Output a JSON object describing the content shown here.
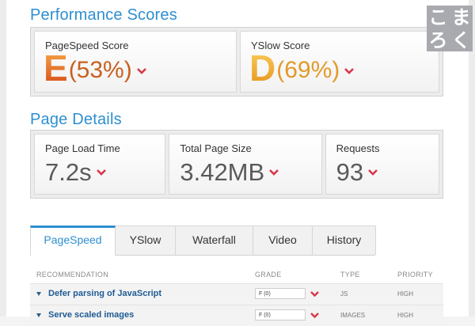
{
  "performance": {
    "title": "Performance Scores",
    "pagespeed": {
      "label": "PageSpeed Score",
      "grade": "E",
      "percent": "(53%)"
    },
    "yslow": {
      "label": "YSlow Score",
      "grade": "D",
      "percent": "(69%)"
    }
  },
  "details": {
    "title": "Page Details",
    "load_time": {
      "label": "Page Load Time",
      "value": "7.2s"
    },
    "page_size": {
      "label": "Total Page Size",
      "value": "3.42MB"
    },
    "requests": {
      "label": "Requests",
      "value": "93"
    }
  },
  "tabs": [
    {
      "label": "PageSpeed",
      "active": true
    },
    {
      "label": "YSlow",
      "active": false
    },
    {
      "label": "Waterfall",
      "active": false
    },
    {
      "label": "Video",
      "active": false
    },
    {
      "label": "History",
      "active": false
    }
  ],
  "table": {
    "headers": {
      "recommendation": "RECOMMENDATION",
      "grade": "GRADE",
      "type": "TYPE",
      "priority": "PRIORITY"
    },
    "rows": [
      {
        "name": "Defer parsing of JavaScript",
        "grade": "F (0)",
        "type": "JS",
        "priority": "HIGH"
      },
      {
        "name": "Serve scaled images",
        "grade": "F (0)",
        "type": "IMAGES",
        "priority": "HIGH"
      }
    ]
  },
  "logo": {
    "chars": [
      "こ",
      "ま",
      "ろ",
      "く"
    ]
  },
  "colors": {
    "accent": "#2e8fd0",
    "chevron": "#d8364a",
    "grade_e": "#e8762b",
    "grade_d": "#f0a830"
  }
}
